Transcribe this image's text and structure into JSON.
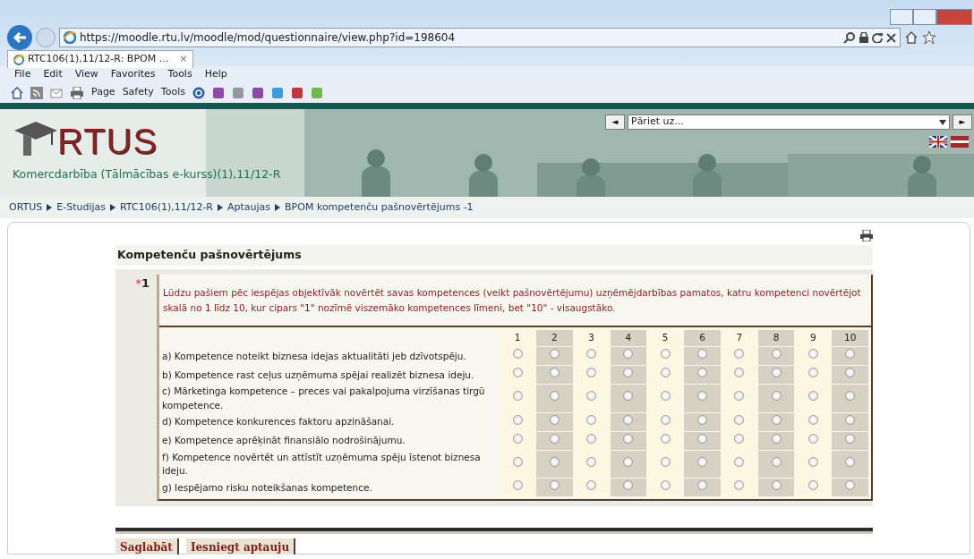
{
  "browser": {
    "address": "https://moodle.rtu.lv/moodle/mod/questionnaire/view.php?id=198604",
    "tab": {
      "title": "RTC106(1),11/12-R: BPOM ...",
      "close": "×"
    },
    "menu": [
      "File",
      "Edit",
      "View",
      "Favorites",
      "Tools",
      "Help"
    ],
    "commands": [
      "Page",
      "Safety",
      "Tools"
    ]
  },
  "header": {
    "logo": "RTUS",
    "course": "Komercdarbība (Tālmācības e-kurss)(1),11/12-R",
    "jump": {
      "value": "Pāriet uz...",
      "prev": "◄",
      "next": "►"
    }
  },
  "breadcrumb": [
    "ORTUS",
    "E-Studijas",
    "RTC106(1),11/12-R",
    "Aptaujas",
    "BPOM kompetenču pašnovērtējums -1"
  ],
  "section_title": "Kompetenču pašnovērtējums",
  "question": {
    "required_mark": "*",
    "number": "1",
    "text": "Lūdzu pašiem pēc iespējas objektīvāk novērtēt savas kompetences (veikt pašnovērtējumu) uzņēmējdarbības pamatos, katru kompetenci novērtējot skalā no 1 līdz 10, kur cipars \"1\" nozīmē viszemāko kompetences līmeni, bet \"10\" - visaugstāko.",
    "scale": [
      "1",
      "2",
      "3",
      "4",
      "5",
      "6",
      "7",
      "8",
      "9",
      "10"
    ],
    "rows": [
      {
        "label": "a) Kompetence noteikt biznesa idejas aktualitāti jeb dzīvotspēju.",
        "options": [
          false,
          false,
          false,
          false,
          false,
          false,
          false,
          false,
          false,
          false
        ]
      },
      {
        "label": "b) Kompetence rast ceļus uzņēmuma spējai realizēt biznesa ideju.",
        "options": [
          false,
          false,
          false,
          false,
          false,
          false,
          false,
          false,
          false,
          false
        ]
      },
      {
        "label": "c) Mārketinga kompetence – preces vai pakalpojuma virzīšanas tirgū kompetence.",
        "options": [
          false,
          false,
          false,
          false,
          false,
          false,
          false,
          false,
          false,
          false
        ]
      },
      {
        "label": "d) Kompetence konkurences faktoru apzināšanai.",
        "options": [
          false,
          false,
          false,
          false,
          false,
          false,
          false,
          false,
          false,
          false
        ]
      },
      {
        "label": "e) Kompetence aprēķināt finansiālo nodrošinājumu.",
        "options": [
          false,
          false,
          false,
          false,
          false,
          false,
          false,
          false,
          false,
          false
        ]
      },
      {
        "label": "f) Kompetence novērtēt un attīstīt uzņēmuma spēju īstenot biznesa ideju.",
        "options": [
          false,
          false,
          false,
          false,
          false,
          false,
          false,
          false,
          false,
          false
        ]
      },
      {
        "label": "g) Iespējamo risku noteikšanas kompetence.",
        "options": [
          false,
          false,
          false,
          false,
          false,
          false,
          false,
          false,
          false,
          false
        ]
      }
    ]
  },
  "buttons": [
    "Saglabāt",
    "Iesniegt aptauju"
  ]
}
